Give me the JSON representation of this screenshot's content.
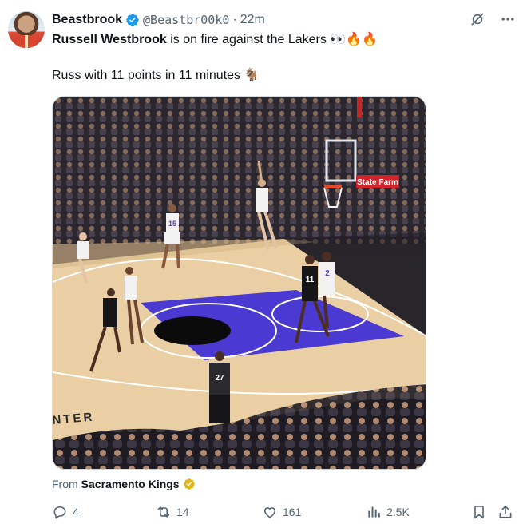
{
  "author": {
    "name": "Beastbrook",
    "handle": "@Beastbr00k0",
    "separator": "·",
    "time": "22m"
  },
  "tweet": {
    "line1_bold": "Russell Westbrook",
    "line1_rest": "is on fire against the Lakers 👀🔥🔥",
    "line2": "Russ with 11 points in 11 minutes 🐐"
  },
  "source": {
    "prefix": "From",
    "name": "Sacramento Kings"
  },
  "metrics": {
    "replies": "4",
    "reposts": "14",
    "likes": "161",
    "views": "2.5K"
  },
  "media": {
    "sponsor_sign": "State Farm",
    "court_text": "NTER",
    "jersey_numbers": [
      "15",
      "11",
      "2",
      "27"
    ]
  },
  "colors": {
    "verified_blue": "#1d9bf0",
    "verified_gold": "#e2b719",
    "text_secondary": "#536471",
    "court_purple": "#4a3ad1"
  },
  "icons": [
    "grok-icon",
    "more-icon",
    "reply-icon",
    "repost-icon",
    "like-icon",
    "views-icon",
    "bookmark-icon",
    "share-icon"
  ]
}
